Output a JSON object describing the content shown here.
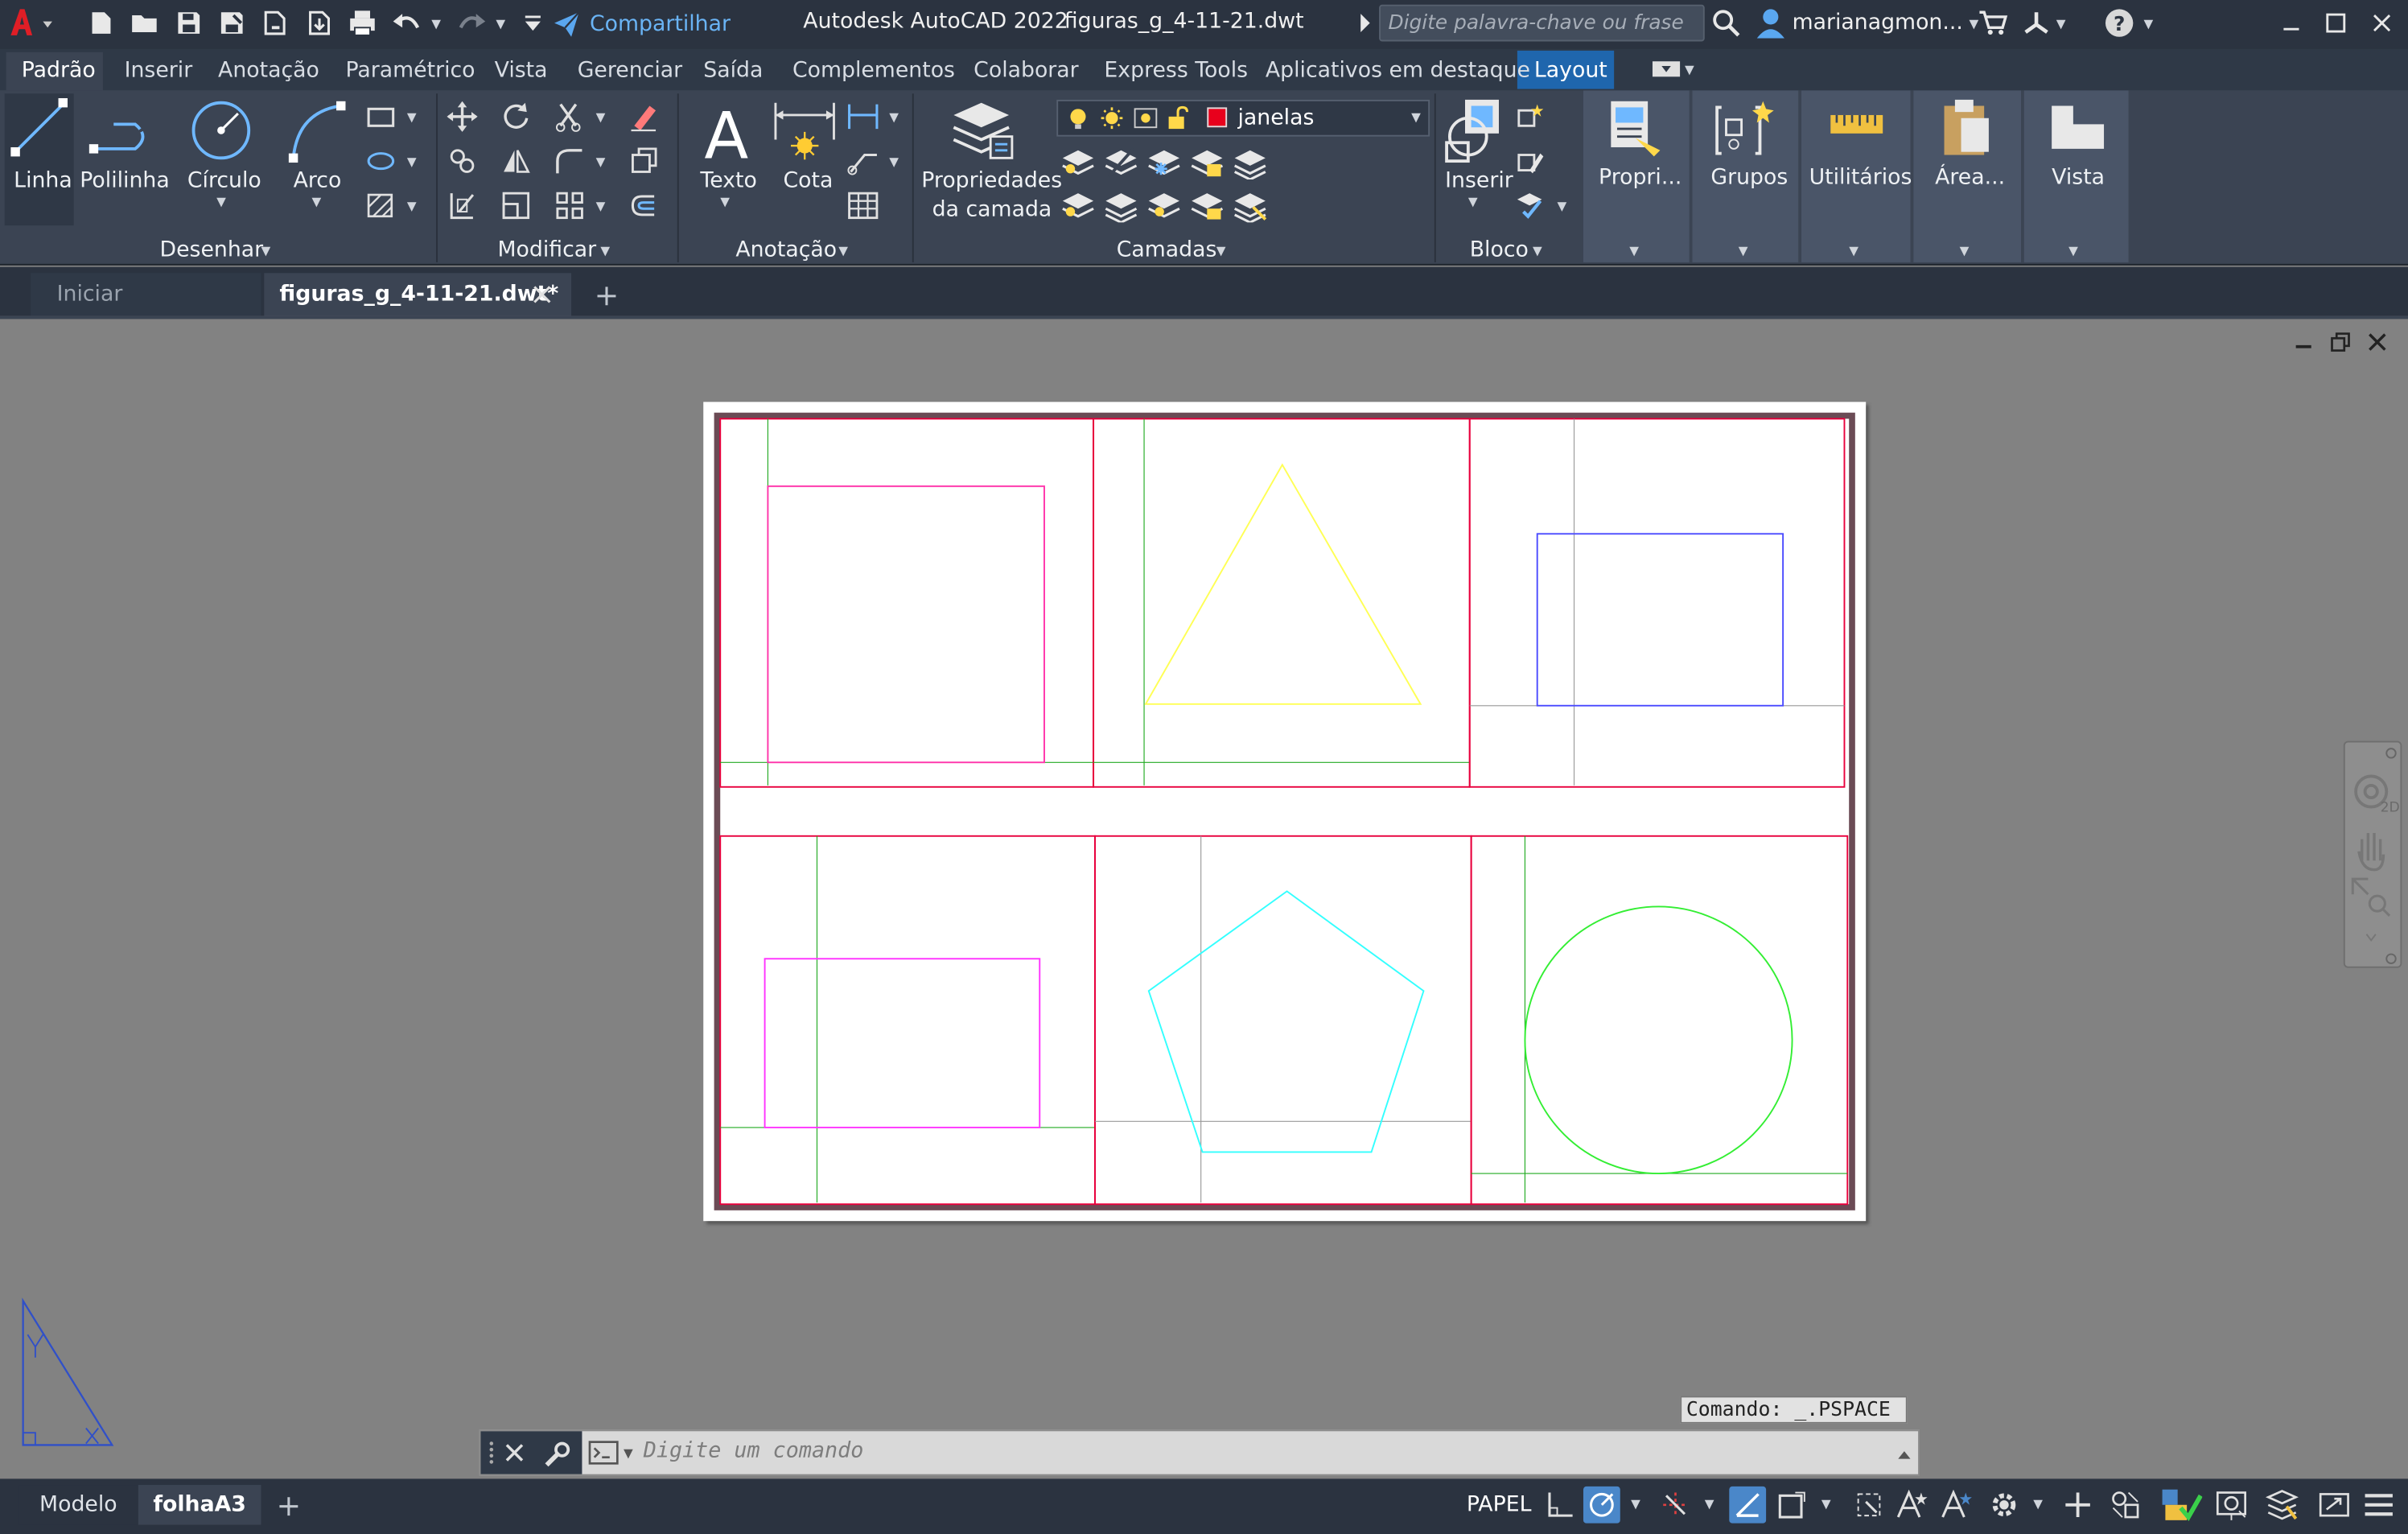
{
  "title_bar": {
    "app_name": "Autodesk AutoCAD 2022",
    "file_name": "figuras_g_4-11-21.dwt",
    "share_label": "Compartilhar",
    "search_placeholder": "Digite palavra-chave ou frase",
    "user_name": "marianagmon...",
    "app_menu_icon": "autocad-a-logo"
  },
  "ribbon_tabs": [
    "Padrão",
    "Inserir",
    "Anotação",
    "Paramétrico",
    "Vista",
    "Gerenciar",
    "Saída",
    "Complementos",
    "Colaborar",
    "Express Tools",
    "Aplicativos em destaque",
    "Layout"
  ],
  "active_tab": "Padrão",
  "highlighted_tab": "Layout",
  "ribbon": {
    "draw": {
      "title": "Desenhar",
      "tools": [
        "Linha",
        "Polilinha",
        "Círculo",
        "Arco"
      ]
    },
    "modify": {
      "title": "Modificar"
    },
    "annotation": {
      "title": "Anotação",
      "tools": [
        "Texto",
        "Cota"
      ]
    },
    "layers": {
      "title": "Camadas",
      "properties_label_1": "Propriedades",
      "properties_label_2": "da camada",
      "current_layer": "janelas",
      "current_layer_color": "#e8001c"
    },
    "block": {
      "title": "Bloco",
      "insert_label": "Inserir"
    },
    "tiles": [
      "Propri...",
      "Grupos",
      "Utilitários",
      "Área...",
      "Vista"
    ]
  },
  "doc_tabs": {
    "start": "Iniciar",
    "active": "figuras_g_4-11-21.dwt*"
  },
  "drawing": {
    "viewports": [
      {
        "shape": "square",
        "color": "#ff33aa"
      },
      {
        "shape": "triangle",
        "color": "#ffff55"
      },
      {
        "shape": "rectangle",
        "color": "#4c4cff"
      },
      {
        "shape": "rectangle",
        "color": "#ff33ff"
      },
      {
        "shape": "pentagon",
        "color": "#33ffff"
      },
      {
        "shape": "circle",
        "color": "#33ee33"
      }
    ],
    "frame_color": "#e8003c",
    "guide_color": "#22aa22"
  },
  "command": {
    "history": "Comando: _.PSPACE",
    "placeholder": "Digite um comando"
  },
  "layout_tabs": [
    "Modelo",
    "folhaA3"
  ],
  "active_layout": "folhaA3",
  "status": {
    "space": "PAPEL"
  }
}
